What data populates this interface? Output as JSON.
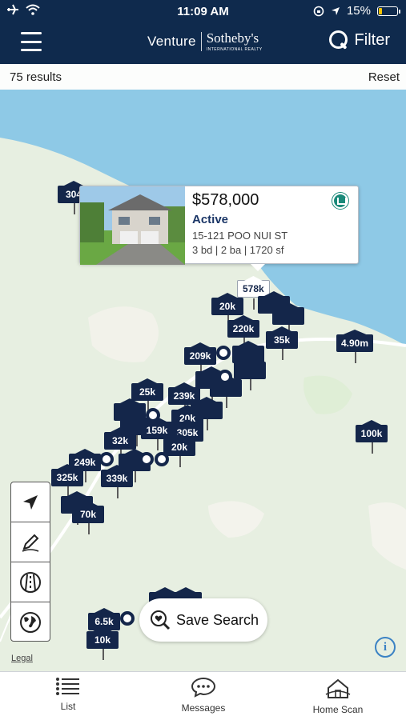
{
  "status_bar": {
    "time": "11:09 AM",
    "battery": "15%"
  },
  "header": {
    "brand_left": "Venture",
    "brand_right": "Sotheby's",
    "brand_tagline": "INTERNATIONAL REALTY",
    "filter_label": "Filter"
  },
  "results": {
    "count_label": "75 results",
    "reset_label": "Reset"
  },
  "popup": {
    "price": "$578,000",
    "status": "Active",
    "address": "15-121  POO NUI ST",
    "details": "3 bd | 2 ba | 1720 sf"
  },
  "pins": [
    "304",
    "578k",
    "20k",
    "220k",
    "209k",
    "35k",
    "4.90m",
    "25k",
    "239k",
    "20k",
    "159k",
    "305k",
    "32k",
    "20k",
    "249k",
    "325k",
    "339k",
    "70k",
    "100k",
    "6.5k",
    "10k"
  ],
  "save_search_label": "Save Search",
  "legal_label": "Legal",
  "tabs": [
    {
      "label": "List",
      "icon": "list-icon"
    },
    {
      "label": "Messages",
      "icon": "messages-icon"
    },
    {
      "label": "Home Scan",
      "icon": "home-scan-icon"
    }
  ],
  "colors": {
    "header": "#0f2a4d",
    "pin": "#14264a",
    "water": "#8ec9e6",
    "land": "#e7efe1"
  }
}
